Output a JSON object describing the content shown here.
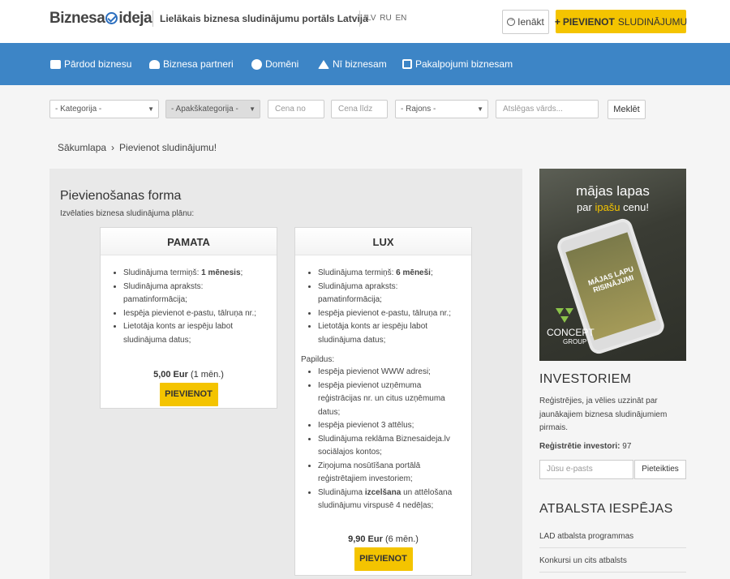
{
  "header": {
    "logo_left": "Biznesa",
    "logo_right": "ideja",
    "tagline": "Lielākais biznesa sludinājumu portāls Latvijā",
    "langs": [
      "LV",
      "RU",
      "EN"
    ],
    "login_label": "Ienākt",
    "add_plus": "+",
    "add_bold": "PIEVIENOT",
    "add_rest": "SLUDINĀJUMU",
    "accent_color": "#f4c400",
    "nav_color": "#3d85c6"
  },
  "nav": {
    "items": [
      {
        "label": "Pārdod biznesu",
        "icon": "briefcase-icon"
      },
      {
        "label": "Biznesa partneri",
        "icon": "users-icon"
      },
      {
        "label": "Domēni",
        "icon": "globe-icon"
      },
      {
        "label": "Nī biznesam",
        "icon": "home-icon"
      },
      {
        "label": "Pakalpojumi biznesam",
        "icon": "edit-icon"
      }
    ]
  },
  "filter": {
    "category": "- Kategorija -",
    "subcategory": "- Apakškategorija -",
    "price_from": "Cena no",
    "price_to": "Cena līdz",
    "region": "- Rajons -",
    "keyword": "Atslēgas vārds...",
    "search_label": "Meklēt"
  },
  "breadcrumb": {
    "home": "Sākumlapa",
    "separator": "›",
    "current": "Pievienot sludinājumu!"
  },
  "form": {
    "title": "Pievienošanas forma",
    "subtitle": "Izvēlaties biznesa sludinājuma plānu:",
    "plans": [
      {
        "name": "PAMATA",
        "features": [
          {
            "text": "Sludinājuma termiņš: ",
            "bold": "1 mēnesis",
            "after": ";"
          },
          {
            "text": "Sludinājuma apraksts: pamatinformācija;",
            "bold": "",
            "after": ""
          },
          {
            "text": "Iespēja pievienot e-pastu, tālruņa nr.;",
            "bold": "",
            "after": ""
          },
          {
            "text": "Lietotāja konts ar iespēju labot sludinājuma datus;",
            "bold": "",
            "after": ""
          }
        ],
        "price_bold": "5,00 Eur",
        "price_rest": "(1 mēn.)",
        "button": "PIEVIENOT"
      },
      {
        "name": "LUX",
        "features": [
          {
            "text": "Sludinājuma termiņš: ",
            "bold": "6 mēneši",
            "after": ";"
          },
          {
            "text": "Sludinājuma apraksts: pamatinformācija;",
            "bold": "",
            "after": ""
          },
          {
            "text": "Iespēja pievienot e-pastu, tālruņa nr.;",
            "bold": "",
            "after": ""
          },
          {
            "text": "Lietotāja konts ar iespēju labot sludinājuma datus;",
            "bold": "",
            "after": ""
          }
        ],
        "extra_label": "Papildus:",
        "extras": [
          {
            "text": "Iespēja pievienot WWW adresi;",
            "bold": "",
            "after": ""
          },
          {
            "text": "Iespēja pievienot uzņēmuma reģistrācijas nr. un citus uzņēmuma datus;",
            "bold": "",
            "after": ""
          },
          {
            "text": "Iespēja pievienot 3 attēlus;",
            "bold": "",
            "after": ""
          },
          {
            "text": "Sludinājuma reklāma Biznesaideja.lv sociālajos kontos;",
            "bold": "",
            "after": ""
          },
          {
            "text": "Ziņojuma nosūtīšana portālā reģistrētajiem investoriem;",
            "bold": "",
            "after": ""
          },
          {
            "text": "Sludinājuma ",
            "bold": "izcelšana",
            "after": " un attēlošana sludinājumu virspusē 4 nedēļas;"
          }
        ],
        "price_bold": "9,90 Eur",
        "price_rest": "(6 mēn.)",
        "button": "PIEVIENOT"
      }
    ]
  },
  "sidebar": {
    "ad": {
      "title": "mājas lapas",
      "sub_pre": "par ",
      "sub_accent": "ipašu",
      "sub_post": " cenu!",
      "phone_text": "MĀJAS LAPU RISINĀJUMI",
      "brand": "CONCEPT",
      "brand_sub": "GROUP"
    },
    "investors_title": "INVESTORIEM",
    "investors_text": "Reģistrējies, ja vēlies uzzināt par jaunākajiem biznesa sludinājumiem pirmais.",
    "investors_count_label": "Reģistrētie investori:",
    "investors_count": "97",
    "email_placeholder": "Jūsu e-pasts",
    "subscribe_label": "Pieteikties",
    "support_title": "ATBALSTA IESPĒJAS",
    "support_links": [
      "LAD atbalsta programmas",
      "Konkursi un cits atbalsts"
    ]
  }
}
